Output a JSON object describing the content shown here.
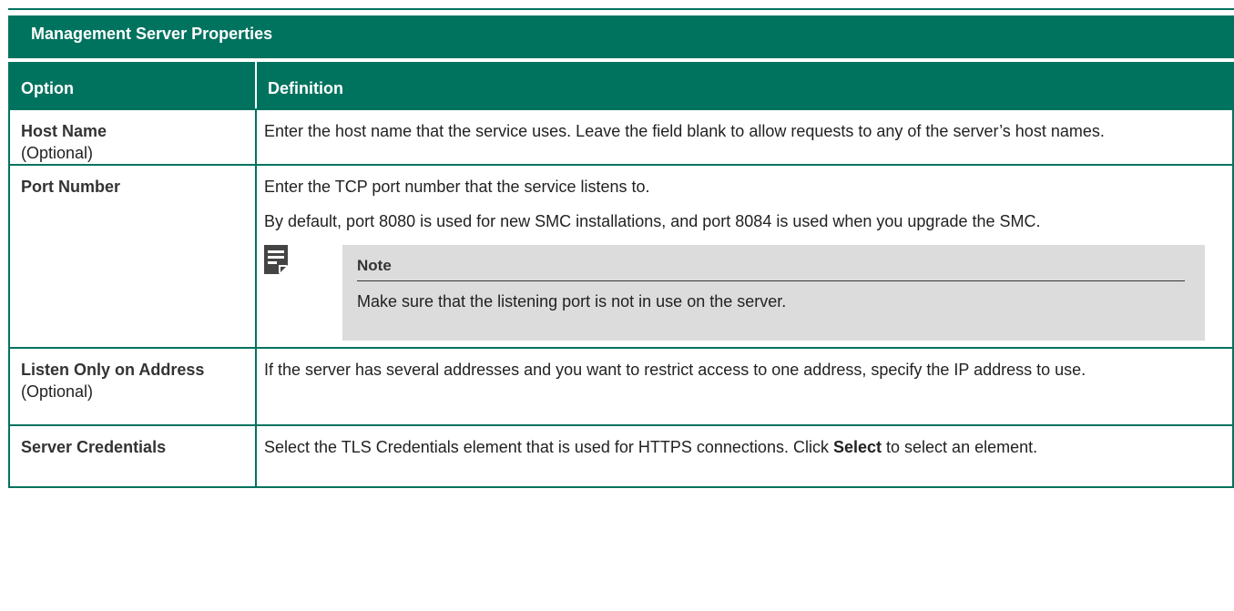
{
  "title": "Management Server Properties",
  "headers": {
    "option": "Option",
    "definition": "Definition"
  },
  "rows": [
    {
      "option": "Host Name",
      "qualifier": "(Optional)",
      "definition": [
        "Enter the host name that the service uses. Leave the field blank to allow requests to any of the server’s host names."
      ]
    },
    {
      "option": "Port Number",
      "qualifier": "",
      "definition": [
        "Enter the TCP port number that the service listens to.",
        "By default, port 8080 is used for new SMC installations, and port 8084 is used when you upgrade the SMC."
      ],
      "note": {
        "title": "Note",
        "text": "Make sure that the listening port is not in use on the server.",
        "icon": "note-icon"
      }
    },
    {
      "option": "Listen Only on Address",
      "qualifier": "(Optional)",
      "definition": [
        "If the server has several addresses and you want to restrict access to one address, specify the IP address to use."
      ]
    },
    {
      "option": "Server Credentials",
      "qualifier": "",
      "definition_parts": [
        "Select the TLS Credentials element that is used for HTTPS connections. Click ",
        "Select",
        " to select an element."
      ]
    }
  ],
  "colors": {
    "header": "#00735f",
    "note_bg": "#dcdcdc",
    "icon": "#444444"
  }
}
